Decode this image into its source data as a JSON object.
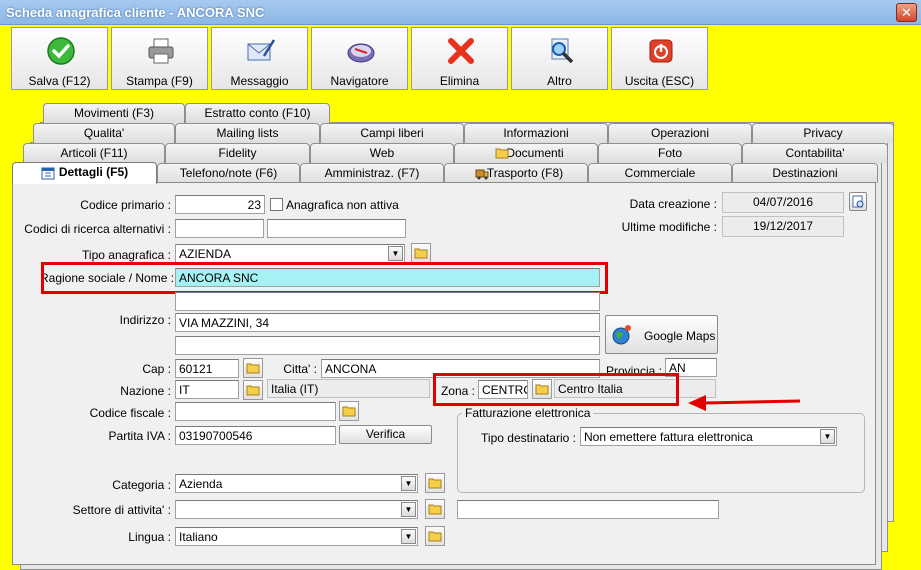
{
  "window": {
    "title": "Scheda anagrafica cliente - ANCORA SNC",
    "close": "✕"
  },
  "toolbar": {
    "save": "Salva (F12)",
    "print": "Stampa (F9)",
    "message": "Messaggio",
    "navigator": "Navigatore",
    "delete": "Elimina",
    "other": "Altro",
    "exit": "Uscita (ESC)"
  },
  "tabs": {
    "row1": [
      "Movimenti (F3)",
      "Estratto conto (F10)"
    ],
    "row2": [
      "Qualita'",
      "Mailing lists",
      "Campi liberi",
      "Informazioni",
      "Operazioni",
      "Privacy"
    ],
    "row3": [
      "Articoli (F11)",
      "Fidelity",
      "Web",
      "Documenti",
      "Foto",
      "Contabilita'"
    ],
    "row4": [
      "Dettagli (F5)",
      "Telefono/note (F6)",
      "Amministraz. (F7)",
      "Trasporto (F8)",
      "Commerciale",
      "Destinazioni"
    ]
  },
  "form": {
    "codice_primario_label": "Codice primario :",
    "codice_primario": "23",
    "anagrafica_non_attiva": "Anagrafica non attiva",
    "codici_ricerca_label": "Codici di ricerca alternativi :",
    "tipo_anagrafica_label": "Tipo anagrafica :",
    "tipo_anagrafica": "AZIENDA",
    "ragione_sociale_label": "Ragione sociale / Nome :",
    "ragione_sociale": "ANCORA SNC",
    "indirizzo_label": "Indirizzo :",
    "indirizzo": "VIA MAZZINI, 34",
    "cap_label": "Cap :",
    "cap": "60121",
    "citta_label": "Citta' :",
    "citta": "ANCONA",
    "provincia_label": "Provincia :",
    "provincia": "AN",
    "nazione_label": "Nazione :",
    "nazione": "IT",
    "nazione_desc": "Italia (IT)",
    "zona_label": "Zona :",
    "zona": "CENTRO",
    "zona_desc": "Centro Italia",
    "codice_fiscale_label": "Codice fiscale :",
    "partita_iva_label": "Partita IVA :",
    "partita_iva": "03190700546",
    "verifica": "Verifica",
    "google_maps": "Google Maps",
    "data_creazione_label": "Data creazione :",
    "data_creazione": "04/07/2016",
    "ultime_modifiche_label": "Ultime modifiche :",
    "ultime_modifiche": "19/12/2017",
    "fatturazione_title": "Fatturazione elettronica",
    "tipo_destinatario_label": "Tipo destinatario :",
    "tipo_destinatario": "Non emettere fattura elettronica",
    "categoria_label": "Categoria :",
    "categoria": "Azienda",
    "settore_label": "Settore di attivita' :",
    "lingua_label": "Lingua :",
    "lingua": "Italiano"
  },
  "colors": {
    "background": "#ffff00",
    "highlight_box": "#e00000",
    "ragione_bg": "#a6f1f4"
  }
}
